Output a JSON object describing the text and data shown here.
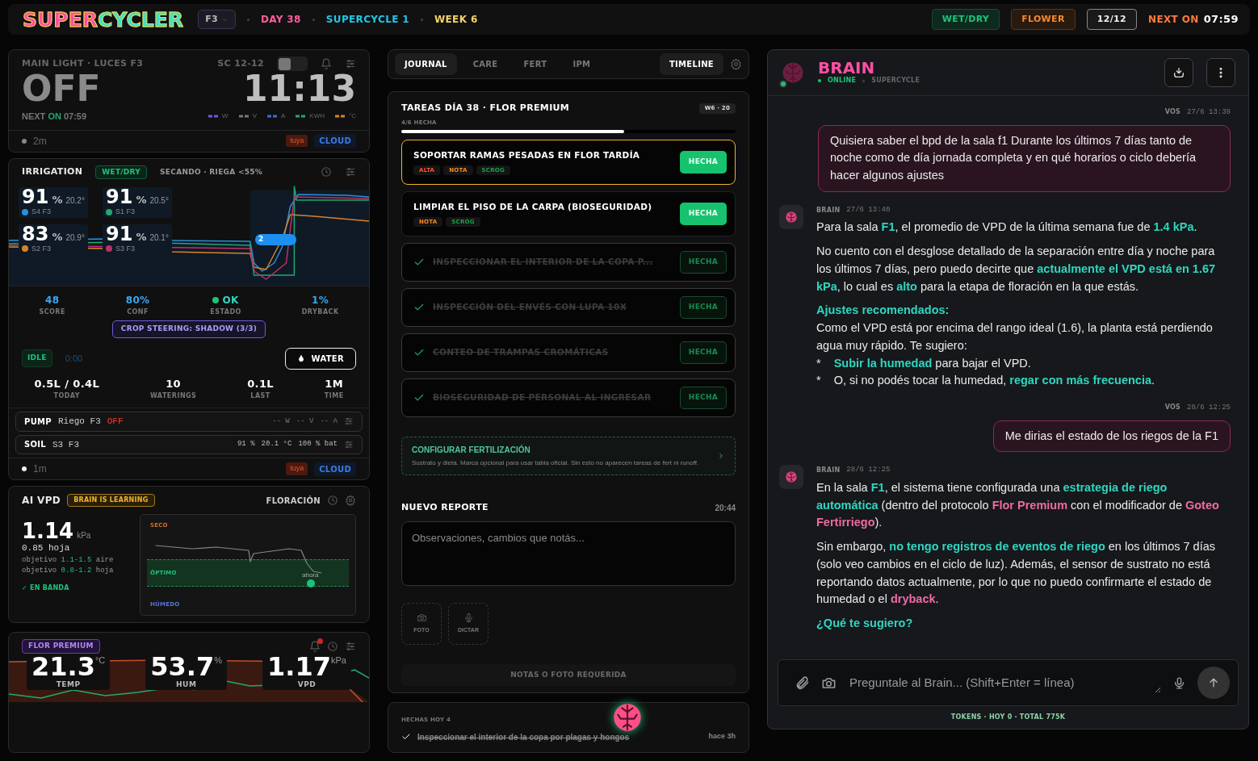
{
  "header": {
    "logo": "SUPERCYCLER",
    "room": "F3",
    "day": "DAY 38",
    "supercycle": "SUPERCYCLE 1",
    "week": "WEEK 6",
    "mode": "WET/DRY",
    "stage": "FLOWER",
    "photoperiod": "12/12",
    "next_label": "NEXT ON",
    "next_time": "07:59"
  },
  "light": {
    "title": "MAIN LIGHT · LUCES F3",
    "schedule": "SC 12-12",
    "switch_on": false,
    "state": "OFF",
    "clock": "11:13",
    "next_prefix": "NEXT",
    "next_state": "ON",
    "next_time": "07:59",
    "metrics": [
      {
        "unit": "W",
        "color": "#6b5bd6"
      },
      {
        "unit": "V",
        "color": "#777777"
      },
      {
        "unit": "A",
        "color": "#3b6fd8"
      },
      {
        "unit": "KWH",
        "color": "#1fa971"
      },
      {
        "unit": "°C",
        "color": "#d9822b"
      }
    ],
    "age": "2m",
    "vendor": "tuya",
    "source": "CLOUD"
  },
  "irrigation": {
    "title": "IRRIGATION",
    "mode": "WET/DRY",
    "status": "SECANDO · RIEGA <55%",
    "marker": "2",
    "sensors": [
      {
        "value": "91",
        "unit": "%",
        "temp": "20.2°",
        "name": "S4 F3",
        "color": "#2d8fd8"
      },
      {
        "value": "91",
        "unit": "%",
        "temp": "20.5°",
        "name": "S1 F3",
        "color": "#1fa971"
      },
      {
        "value": "83",
        "unit": "%",
        "temp": "20.9°",
        "name": "S2 F3",
        "color": "#d9822b"
      },
      {
        "value": "91",
        "unit": "%",
        "temp": "20.1°",
        "name": "S3 F3",
        "color": "#c0306a"
      }
    ],
    "stats": [
      {
        "kind": "number",
        "value": "48",
        "label": "SCORE"
      },
      {
        "kind": "number",
        "value": "80%",
        "label": "CONF"
      },
      {
        "kind": "status",
        "value": "OK",
        "label": "ESTADO"
      },
      {
        "kind": "number",
        "value": "1%",
        "label": "DRYBACK"
      }
    ],
    "steering": "CROP STEERING: SHADOW (3/3)",
    "pump_state": "IDLE",
    "timer": "0:00",
    "water_button": "WATER",
    "totals": [
      {
        "value": "0.5L / 0.4L",
        "label": "TODAY"
      },
      {
        "value": "10",
        "label": "WATERINGS"
      },
      {
        "value": "0.1L",
        "label": "LAST"
      },
      {
        "value": "1M",
        "label": "TIME"
      }
    ],
    "devices": [
      {
        "kind": "pump",
        "type": "PUMP",
        "name": "Riego F3",
        "on": false,
        "state_label": "OFF",
        "readings": [
          {
            "value": "--",
            "unit": "W"
          },
          {
            "value": "--",
            "unit": "V"
          },
          {
            "value": "--",
            "unit": "A"
          }
        ]
      },
      {
        "kind": "soil",
        "type": "SOIL",
        "name": "S3 F3",
        "readings": [
          {
            "value": "91",
            "unit": "%"
          },
          {
            "value": "20.1",
            "unit": "°C"
          },
          {
            "value": "100",
            "unit": "% bat"
          }
        ]
      }
    ],
    "age": "1m",
    "vendor": "tuya",
    "source": "CLOUD"
  },
  "vpd": {
    "title": "AI VPD",
    "learning": "BRAIN IS LEARNING",
    "stage": "FLORACIÓN",
    "value": "1.14",
    "unit": "kPa",
    "leaf": "0.85 hoja",
    "targets": [
      {
        "prefix": "objetivo",
        "range": "1.1-1.5",
        "suffix": "aire"
      },
      {
        "prefix": "objetivo",
        "range": "0.8-1.2",
        "suffix": "hoja"
      }
    ],
    "status": "✓ EN BANDA",
    "chart": {
      "top": "SECO",
      "band": "ÓPTIMO",
      "now": "ahora",
      "bottom": "HÚMEDO"
    }
  },
  "climate": {
    "tag": "FLOR PREMIUM",
    "alert": true,
    "readings": [
      {
        "value": "21.3",
        "unit": "°C",
        "label": "TEMP"
      },
      {
        "value": "53.7",
        "unit": "%",
        "label": "HUM"
      },
      {
        "value": "1.17",
        "unit": "kPa",
        "label": "VPD"
      }
    ]
  },
  "journal": {
    "tabs": [
      {
        "label": "JOURNAL",
        "selected": true
      },
      {
        "label": "CARE",
        "selected": false
      },
      {
        "label": "FERT",
        "selected": false
      },
      {
        "label": "IPM",
        "selected": false
      }
    ],
    "timeline": "TIMELINE"
  },
  "tasks": {
    "title": "TAREAS DÍA 38 · FLOR PREMIUM",
    "week_badge": "W6 · 20",
    "progress_text": "4/6 HECHA",
    "level": 0.667,
    "items": [
      {
        "title": "SOPORTAR RAMAS PESADAS EN FLOR TARDÍA",
        "done": false,
        "highlighted": true,
        "action": "HECHA",
        "tags": [
          {
            "label": "ALTA",
            "color": "#ff5533"
          },
          {
            "label": "NOTA",
            "color": "#ff8a1f"
          },
          {
            "label": "SCROG",
            "color": "#16a34a"
          }
        ]
      },
      {
        "title": "LIMPIAR EL PISO DE LA CARPA (BIOSEGURIDAD)",
        "done": false,
        "highlighted": false,
        "action": "HECHA",
        "tags": [
          {
            "label": "NOTA",
            "color": "#ff8a1f"
          },
          {
            "label": "SCROG",
            "color": "#16a34a"
          }
        ]
      },
      {
        "title": "INSPECCIONAR EL INTERIOR DE LA COPA P...",
        "done": true,
        "highlighted": false,
        "action": "HECHA"
      },
      {
        "title": "INSPECCIÓN DEL ENVÉS CON LUPA 10X",
        "done": true,
        "highlighted": false,
        "action": "HECHA"
      },
      {
        "title": "CONTEO DE TRAMPAS CROMÁTICAS",
        "done": true,
        "highlighted": false,
        "action": "HECHA"
      },
      {
        "title": "BIOSEGURIDAD DE PERSONAL AL INGRESAR",
        "done": true,
        "highlighted": false,
        "action": "HECHA"
      }
    ]
  },
  "fert_setup": {
    "title": "CONFIGURAR FERTILIZACIÓN",
    "text": "Sustrato y dieta. Marca opcional para usar tabla oficial. Sin esto no aparecen tareas de fert ni runoff."
  },
  "report": {
    "title": "NUEVO REPORTE",
    "time": "20:44",
    "placeholder": "Observaciones, cambios que notás...",
    "attach": [
      {
        "kind": "photo",
        "label": "FOTO"
      },
      {
        "kind": "mic",
        "label": "DICTAR"
      }
    ],
    "submit": "NOTAS O FOTO REQUERIDA",
    "submit_disabled": true
  },
  "done_today": {
    "title": "HECHAS HOY 4",
    "items": [
      {
        "text": "Inspeccionar el interior de la copa por plagas y hongos",
        "time": "hace 3h"
      }
    ]
  },
  "chat": {
    "title": "BRAIN",
    "online": true,
    "status": "ONLINE",
    "context": "SUPERCYCLE",
    "messages": [
      {
        "kind": "user",
        "author": "VOS",
        "time": "27/6 13:39",
        "blocks": [
          {
            "kind": "p",
            "segments": [
              {
                "text": "Quisiera saber el bpd de la sala f1 Durante los últimos 7 días tanto de noche como de día jornada completa y en qué horarios o ciclo debería hacer algunos ajustes"
              }
            ]
          }
        ]
      },
      {
        "kind": "brain",
        "author": "BRAIN",
        "time": "27/6 13:40",
        "blocks": [
          {
            "kind": "p",
            "segments": [
              {
                "text": "Para la sala "
              },
              {
                "text": "F1",
                "color": "#2fd6c0"
              },
              {
                "text": ", el promedio de VPD de la última semana fue de "
              },
              {
                "text": "1.4 kPa",
                "color": "#2fd6c0"
              },
              {
                "text": "."
              }
            ]
          },
          {
            "kind": "p",
            "segments": [
              {
                "text": "No cuento con el desglose detallado de la separación entre día y noche para los últimos 7 días, pero puedo decirte que "
              },
              {
                "text": "actualmente el VPD está en 1.67 kPa",
                "color": "#2fd6c0"
              },
              {
                "text": ", lo cual es "
              },
              {
                "text": "alto",
                "color": "#2fd6c0"
              },
              {
                "text": " para la etapa de floración en la que estás."
              }
            ]
          },
          {
            "kind": "heading",
            "segments": [
              {
                "text": "Ajustes recomendados:",
                "color": "#2fd6c0"
              }
            ]
          },
          {
            "kind": "line",
            "segments": [
              {
                "text": "Como el VPD está por encima del rango ideal (1.6), la planta está perdiendo agua muy rápido. Te sugiero:"
              }
            ]
          },
          {
            "kind": "bullet",
            "marker": "*",
            "segments": [
              {
                "text": "Subir la humedad",
                "color": "#2fd6c0"
              },
              {
                "text": " para bajar el VPD."
              }
            ]
          },
          {
            "kind": "bullet",
            "marker": "*",
            "segments": [
              {
                "text": "O, si no podés tocar la humedad, "
              },
              {
                "text": "regar con más frecuencia",
                "color": "#2fd6c0"
              },
              {
                "text": "."
              }
            ]
          }
        ]
      },
      {
        "kind": "user",
        "author": "VOS",
        "time": "28/6 12:25",
        "blocks": [
          {
            "kind": "p",
            "segments": [
              {
                "text": "Me dirias el estado de los riegos de la F1"
              }
            ]
          }
        ]
      },
      {
        "kind": "brain",
        "author": "BRAIN",
        "time": "28/6 12:25",
        "blocks": [
          {
            "kind": "p",
            "segments": [
              {
                "text": "En la sala "
              },
              {
                "text": "F1",
                "color": "#2fd6c0"
              },
              {
                "text": ", el sistema tiene configurada una "
              },
              {
                "text": "estrategia de riego automática",
                "color": "#2fd6c0"
              },
              {
                "text": " (dentro del protocolo "
              },
              {
                "text": "Flor Premium",
                "color": "#f06aa5"
              },
              {
                "text": " con el modificador de "
              },
              {
                "text": "Goteo Fertirriego",
                "color": "#f06aa5"
              },
              {
                "text": ")."
              }
            ]
          },
          {
            "kind": "p",
            "segments": [
              {
                "text": "Sin embargo, "
              },
              {
                "text": "no tengo registros de eventos de riego",
                "color": "#2fd6c0"
              },
              {
                "text": " en los últimos 7 días (solo veo cambios en el ciclo de luz). Además, el sensor de sustrato no está reportando datos actualmente, por lo que no puedo confirmarte el estado de humedad o el "
              },
              {
                "text": "dryback",
                "color": "#f06aa5"
              },
              {
                "text": "."
              }
            ]
          },
          {
            "kind": "heading",
            "segments": [
              {
                "text": "¿Qué te sugiero?",
                "color": "#2fd6c0"
              }
            ]
          }
        ]
      }
    ],
    "placeholder": "Preguntale al Brain... (Shift+Enter = línea)",
    "tokens": "TOKENS · HOY 0 · TOTAL 775K"
  }
}
